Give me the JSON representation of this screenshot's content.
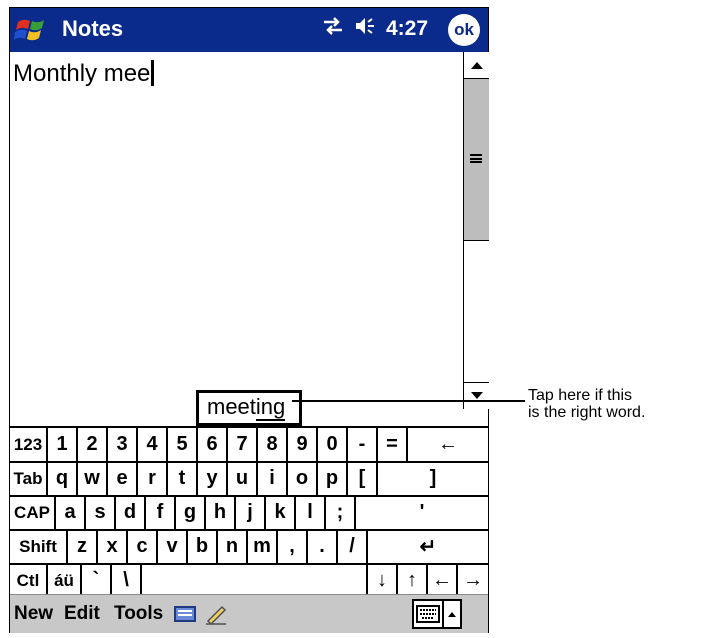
{
  "titlebar": {
    "app_title": "Notes",
    "time": "4:27",
    "ok_label": "ok"
  },
  "note": {
    "text": "Monthly mee"
  },
  "suggestion": {
    "prefix": "meet",
    "suffix": "ing"
  },
  "keyboard": {
    "row1": [
      "123",
      "1",
      "2",
      "3",
      "4",
      "5",
      "6",
      "7",
      "8",
      "9",
      "0",
      "-",
      "=",
      "←"
    ],
    "row2": [
      "Tab",
      "q",
      "w",
      "e",
      "r",
      "t",
      "y",
      "u",
      "i",
      "o",
      "p",
      "[",
      "]"
    ],
    "row3": [
      "CAP",
      "a",
      "s",
      "d",
      "f",
      "g",
      "h",
      "j",
      "k",
      "l",
      ";",
      "'"
    ],
    "row4": [
      "Shift",
      "z",
      "x",
      "c",
      "v",
      "b",
      "n",
      "m",
      ",",
      ".",
      "/",
      "↵"
    ],
    "row5": [
      "Ctl",
      "áü",
      "`",
      "\\",
      "",
      "↓",
      "↑",
      "←",
      "→"
    ]
  },
  "menubar": {
    "new": "New",
    "edit": "Edit",
    "tools": "Tools"
  },
  "callout": {
    "line1": "Tap here if this",
    "line2": "is the right word."
  },
  "colors": {
    "titlebar": "#0a2a8c",
    "menubar": "#c8c8c8",
    "scroll_thumb": "#bdbdbd"
  },
  "icons": [
    "windows-start-icon",
    "connectivity-icon",
    "speaker-icon",
    "ok-icon",
    "input-panel-icon",
    "pen-icon",
    "keyboard-icon",
    "chevron-up-icon",
    "scroll-up-icon",
    "scroll-down-icon"
  ]
}
